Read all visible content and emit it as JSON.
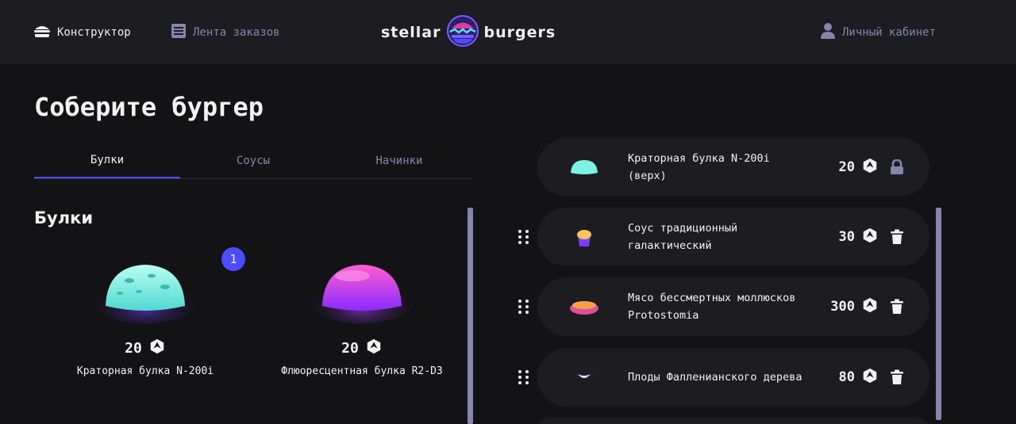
{
  "header": {
    "nav_constructor": "Конструктор",
    "nav_feed": "Лента заказов",
    "nav_profile": "Личный кабинет",
    "logo_left": "stellar",
    "logo_right": "burgers"
  },
  "page": {
    "title": "Соберите бургер"
  },
  "tabs": [
    {
      "label": "Булки",
      "active": true
    },
    {
      "label": "Соусы",
      "active": false
    },
    {
      "label": "Начинки",
      "active": false
    }
  ],
  "section": {
    "title": "Булки"
  },
  "ingredients": [
    {
      "name": "Краторная булка N-200i",
      "price": "20",
      "count": "1",
      "image": "crater-bun"
    },
    {
      "name": "Флюоресцентная булка R2-D3",
      "price": "20",
      "image": "fluorescent-bun"
    }
  ],
  "constructor": {
    "items": [
      {
        "name": "Краторная булка N-200i (верх)",
        "price": "20",
        "action": "lock-icon",
        "image": "crater-bun"
      },
      {
        "name": "Соус традиционный галактический",
        "price": "30",
        "action": "trash-icon",
        "image": "sauce"
      },
      {
        "name": "Мясо бессмертных моллюсков Protostomia",
        "price": "300",
        "action": "trash-icon",
        "image": "meat"
      },
      {
        "name": "Плоды Фалленианского дерева",
        "price": "80",
        "action": "trash-icon",
        "image": "fruit"
      }
    ]
  },
  "colors": {
    "background": "#131316",
    "header": "#1c1c21",
    "accent": "#4c4cff",
    "inactive": "#8585ad",
    "text": "#f2f2f3"
  }
}
